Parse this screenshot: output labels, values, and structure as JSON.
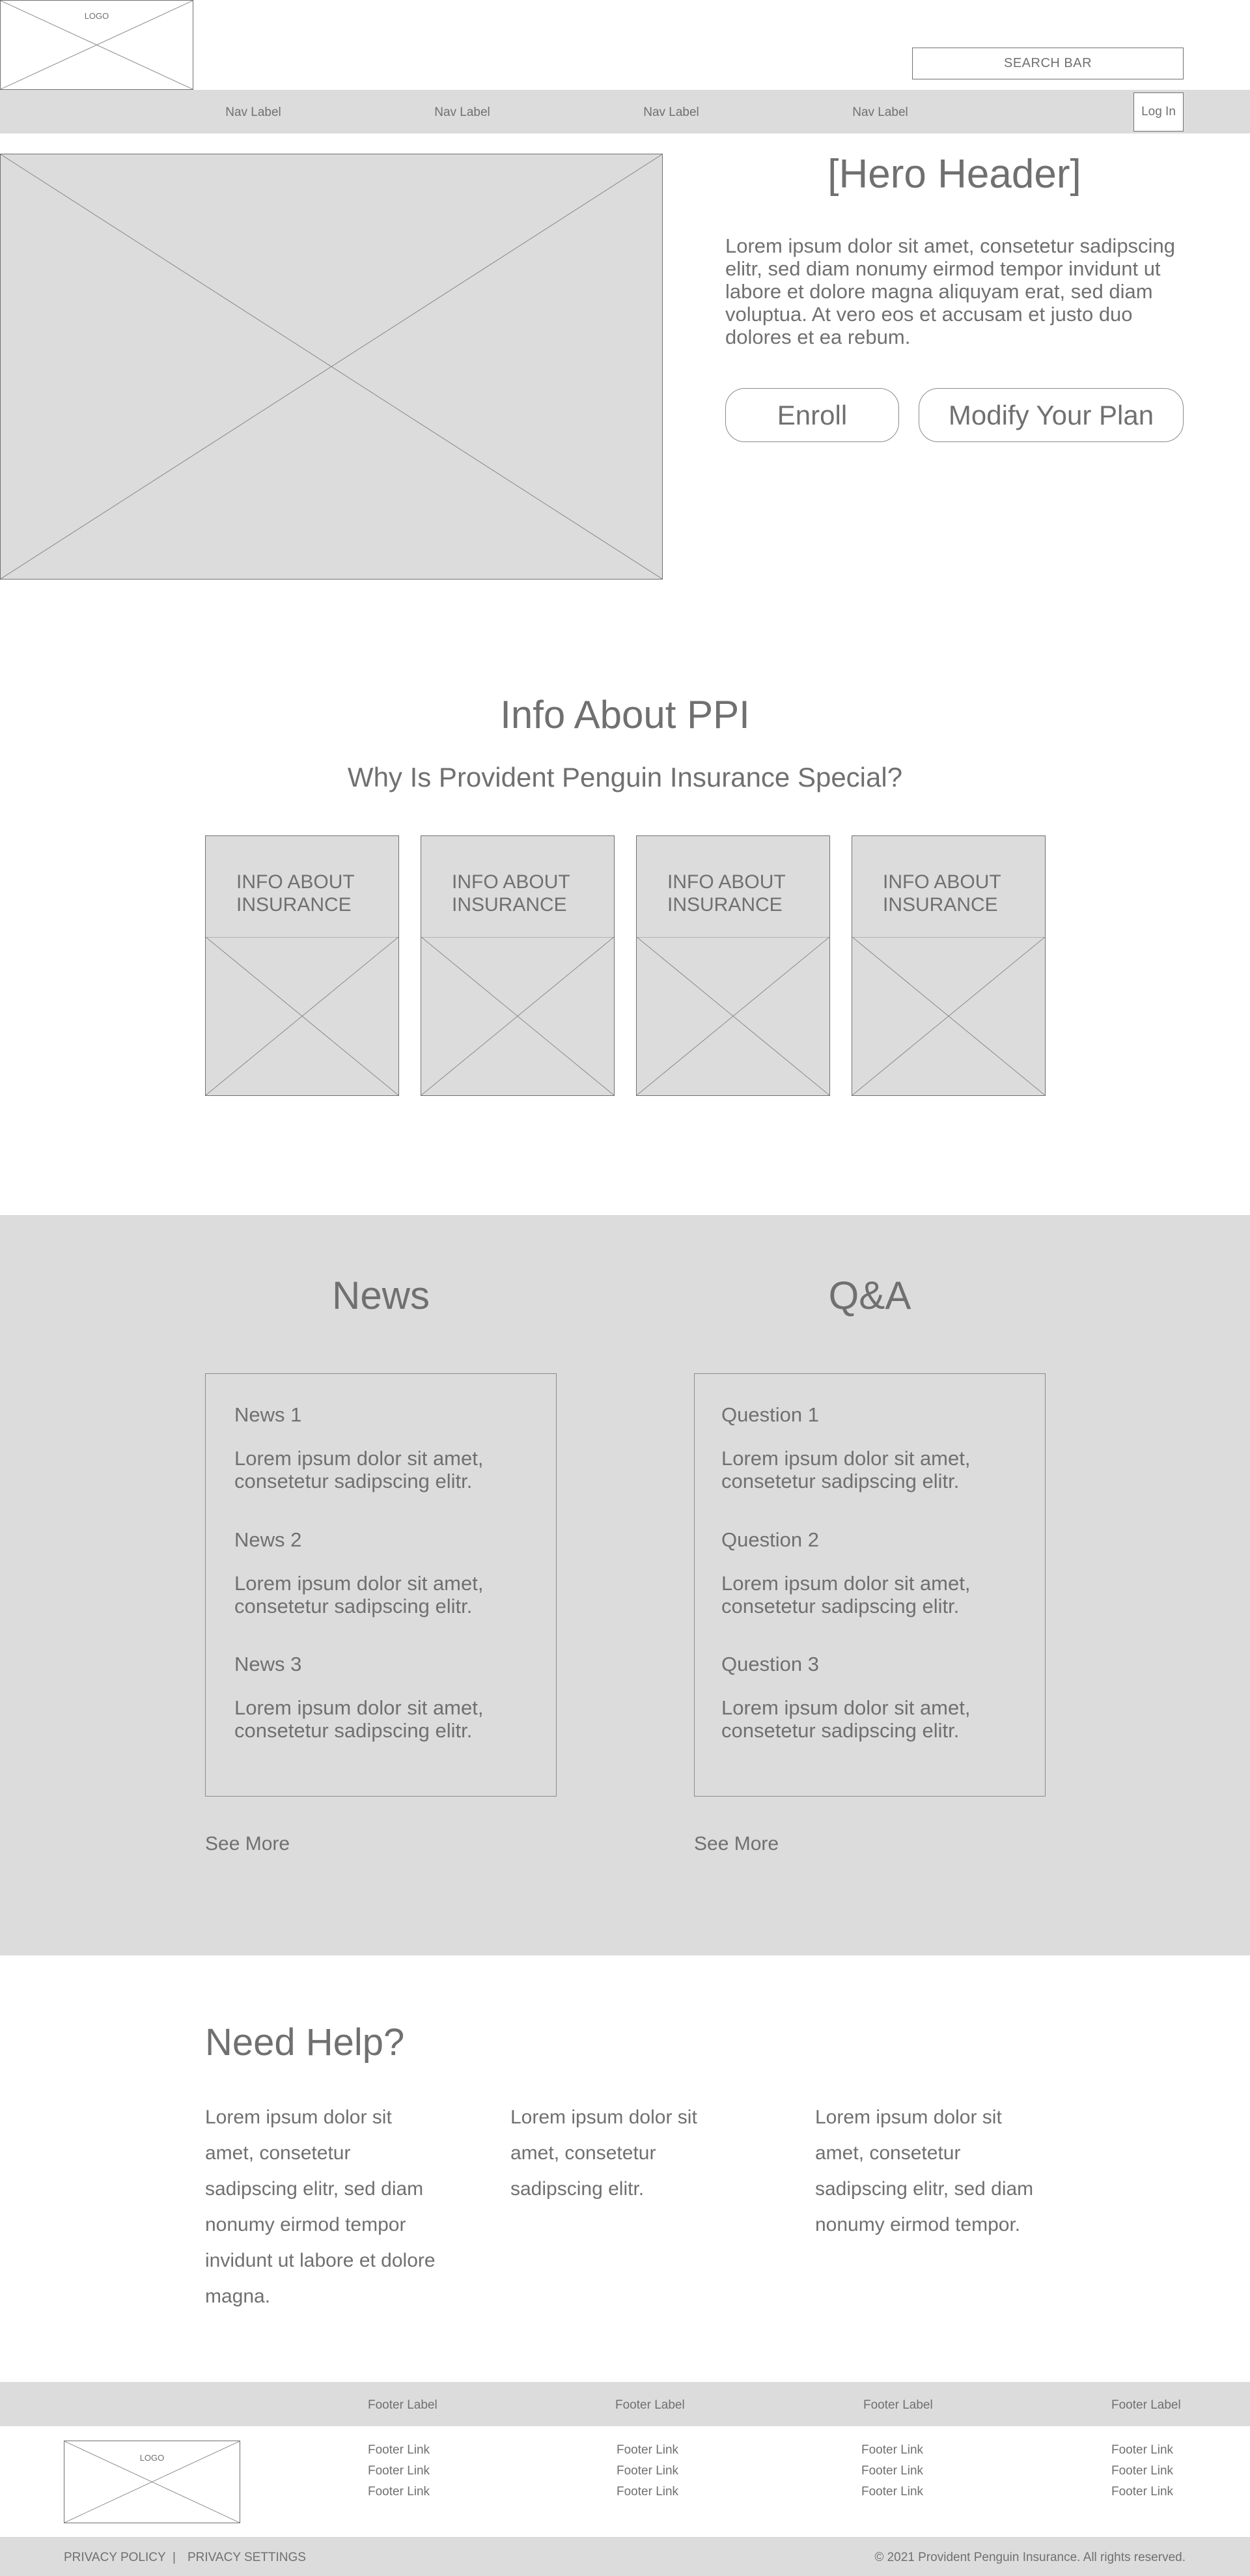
{
  "header": {
    "logo_text": "LOGO",
    "search_placeholder": "SEARCH BAR",
    "nav_items": [
      "Nav Label",
      "Nav Label",
      "Nav Label",
      "Nav Label"
    ],
    "login_label": "Log In"
  },
  "hero": {
    "title": "[Hero Header]",
    "body": "Lorem ipsum dolor sit amet, consetetur sadipscing elitr, sed diam nonumy eirmod tempor invidunt ut labore et dolore magna aliquyam erat, sed diam voluptua. At vero eos et accusam et justo duo dolores et ea rebum.",
    "enroll_label": "Enroll",
    "modify_label": "Modify Your Plan"
  },
  "info": {
    "title": "Info About PPI",
    "subtitle": "Why Is Provident Penguin Insurance Special?",
    "cards": [
      {
        "title": "INFO ABOUT INSURANCE"
      },
      {
        "title": "INFO ABOUT INSURANCE"
      },
      {
        "title": "INFO ABOUT INSURANCE"
      },
      {
        "title": "INFO ABOUT INSURANCE"
      }
    ]
  },
  "news": {
    "title": "News",
    "items": [
      {
        "title": "News 1",
        "body": "Lorem ipsum dolor sit amet, consetetur sadipscing elitr."
      },
      {
        "title": "News 2",
        "body": "Lorem ipsum dolor sit amet, consetetur sadipscing elitr."
      },
      {
        "title": "News 3",
        "body": "Lorem ipsum dolor sit amet, consetetur sadipscing elitr."
      }
    ],
    "see_more": "See More"
  },
  "qa": {
    "title": "Q&A",
    "items": [
      {
        "title": "Question 1",
        "body": "Lorem ipsum dolor sit amet, consetetur sadipscing elitr."
      },
      {
        "title": "Question 2",
        "body": "Lorem ipsum dolor sit amet, consetetur sadipscing elitr."
      },
      {
        "title": "Question 3",
        "body": "Lorem ipsum dolor sit amet, consetetur sadipscing elitr."
      }
    ],
    "see_more": "See More"
  },
  "help": {
    "title": "Need Help?",
    "columns": [
      "Lorem ipsum dolor sit amet, consetetur sadipscing elitr, sed diam nonumy eirmod tempor invidunt ut labore et dolore magna.",
      "Lorem ipsum dolor sit amet, consetetur sadipscing elitr.",
      "Lorem ipsum dolor sit amet, consetetur sadipscing elitr, sed diam nonumy eirmod tempor."
    ]
  },
  "footer": {
    "logo_text": "LOGO",
    "labels": [
      "Footer Label",
      "Footer Label",
      "Footer Label",
      "Footer Label"
    ],
    "links": [
      "Footer Link",
      "Footer Link",
      "Footer Link"
    ],
    "privacy_policy": "PRIVACY POLICY",
    "separator": "|",
    "privacy_settings": "PRIVACY SETTINGS",
    "copyright": "© 2021 Provident Penguin Insurance. All rights reserved."
  },
  "colors": {
    "placeholder_gray": "#dcdcdc",
    "text_gray": "#707070",
    "stroke_gray": "#8a8a8a"
  }
}
